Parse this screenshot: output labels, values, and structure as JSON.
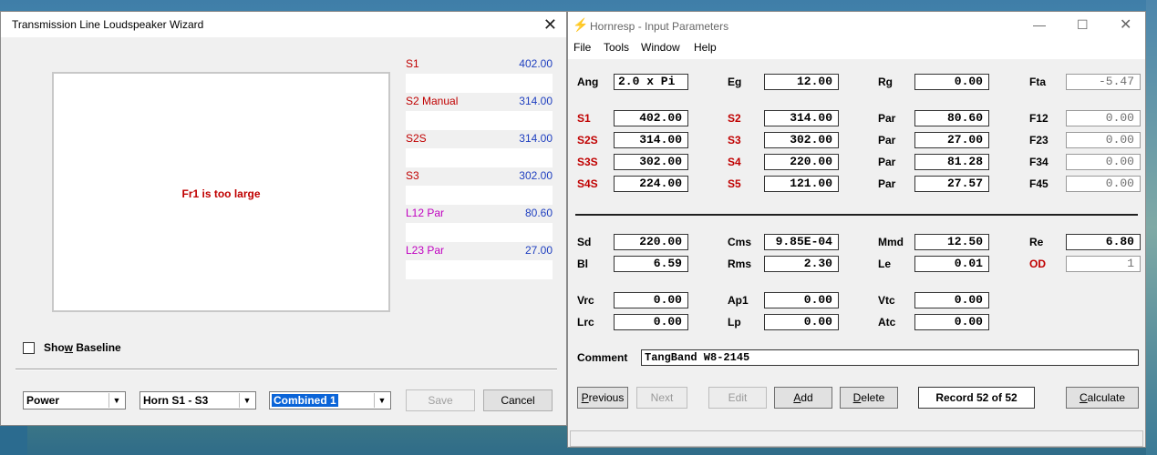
{
  "wizard": {
    "title": "Transmission Line Loudspeaker Wizard",
    "close_glyph": "✕",
    "plot_message": "Fr1 is too large",
    "params": [
      {
        "name": "S1",
        "value": "402.00",
        "color": "#c00000"
      },
      {
        "name": "S2 Manual",
        "value": "314.00",
        "color": "#c00000"
      },
      {
        "name": "S2S",
        "value": "314.00",
        "color": "#c00000"
      },
      {
        "name": "S3",
        "value": "302.00",
        "color": "#c00000"
      },
      {
        "name": "L12 Par",
        "value": "80.60",
        "color": "#c000c0"
      },
      {
        "name": "L23 Par",
        "value": "27.00",
        "color": "#c000c0"
      }
    ],
    "show_baseline": {
      "pre": "Sho",
      "accel": "w",
      "post": " Baseline",
      "checked": false
    },
    "combos": {
      "mode": "Power",
      "section": "Horn S1 - S3",
      "combined": "Combined 1"
    },
    "buttons": {
      "save": "Save",
      "cancel": "Cancel"
    }
  },
  "hornresp": {
    "title": "Hornresp - Input Parameters",
    "icon": "lightning-icon",
    "menu": [
      "File",
      "Tools",
      "Window",
      "Help"
    ],
    "row0": {
      "ang_label": "Ang",
      "ang": "2.0 x Pi",
      "eg_label": "Eg",
      "eg": "12.00",
      "rg_label": "Rg",
      "rg": "0.00",
      "fta_label": "Fta",
      "fta": "-5.47"
    },
    "horn_rows": [
      {
        "a": "S1",
        "av": "402.00",
        "b": "S2",
        "bv": "314.00",
        "c": "Par",
        "cv": "80.60",
        "d": "F12",
        "dv": "0.00"
      },
      {
        "a": "S2S",
        "av": "314.00",
        "b": "S3",
        "bv": "302.00",
        "c": "Par",
        "cv": "27.00",
        "d": "F23",
        "dv": "0.00"
      },
      {
        "a": "S3S",
        "av": "302.00",
        "b": "S4",
        "bv": "220.00",
        "c": "Par",
        "cv": "81.28",
        "d": "F34",
        "dv": "0.00"
      },
      {
        "a": "S4S",
        "av": "224.00",
        "b": "S5",
        "bv": "121.00",
        "c": "Par",
        "cv": "27.57",
        "d": "F45",
        "dv": "0.00"
      }
    ],
    "driver": {
      "sd_label": "Sd",
      "sd": "220.00",
      "cms_label": "Cms",
      "cms": "9.85E-04",
      "mmd_label": "Mmd",
      "mmd": "12.50",
      "re_label": "Re",
      "re": "6.80",
      "bl_label": "Bl",
      "bl": "6.59",
      "rms_label": "Rms",
      "rms": "2.30",
      "le_label": "Le",
      "le": "0.01",
      "od_label": "OD",
      "od": "1"
    },
    "chambers": {
      "vrc_label": "Vrc",
      "vrc": "0.00",
      "ap1_label": "Ap1",
      "ap1": "0.00",
      "vtc_label": "Vtc",
      "vtc": "0.00",
      "lrc_label": "Lrc",
      "lrc": "0.00",
      "lp_label": "Lp",
      "lp": "0.00",
      "atc_label": "Atc",
      "atc": "0.00"
    },
    "comment_label": "Comment",
    "comment": "TangBand W8-2145",
    "buttons": {
      "previous": {
        "accel": "P",
        "rest": "revious"
      },
      "next": "Next",
      "edit": "Edit",
      "add": {
        "accel": "A",
        "rest": "dd"
      },
      "delete": {
        "accel": "D",
        "rest": "elete"
      },
      "calculate": {
        "accel": "C",
        "rest": "alculate"
      }
    },
    "record": "Record 52 of 52"
  }
}
